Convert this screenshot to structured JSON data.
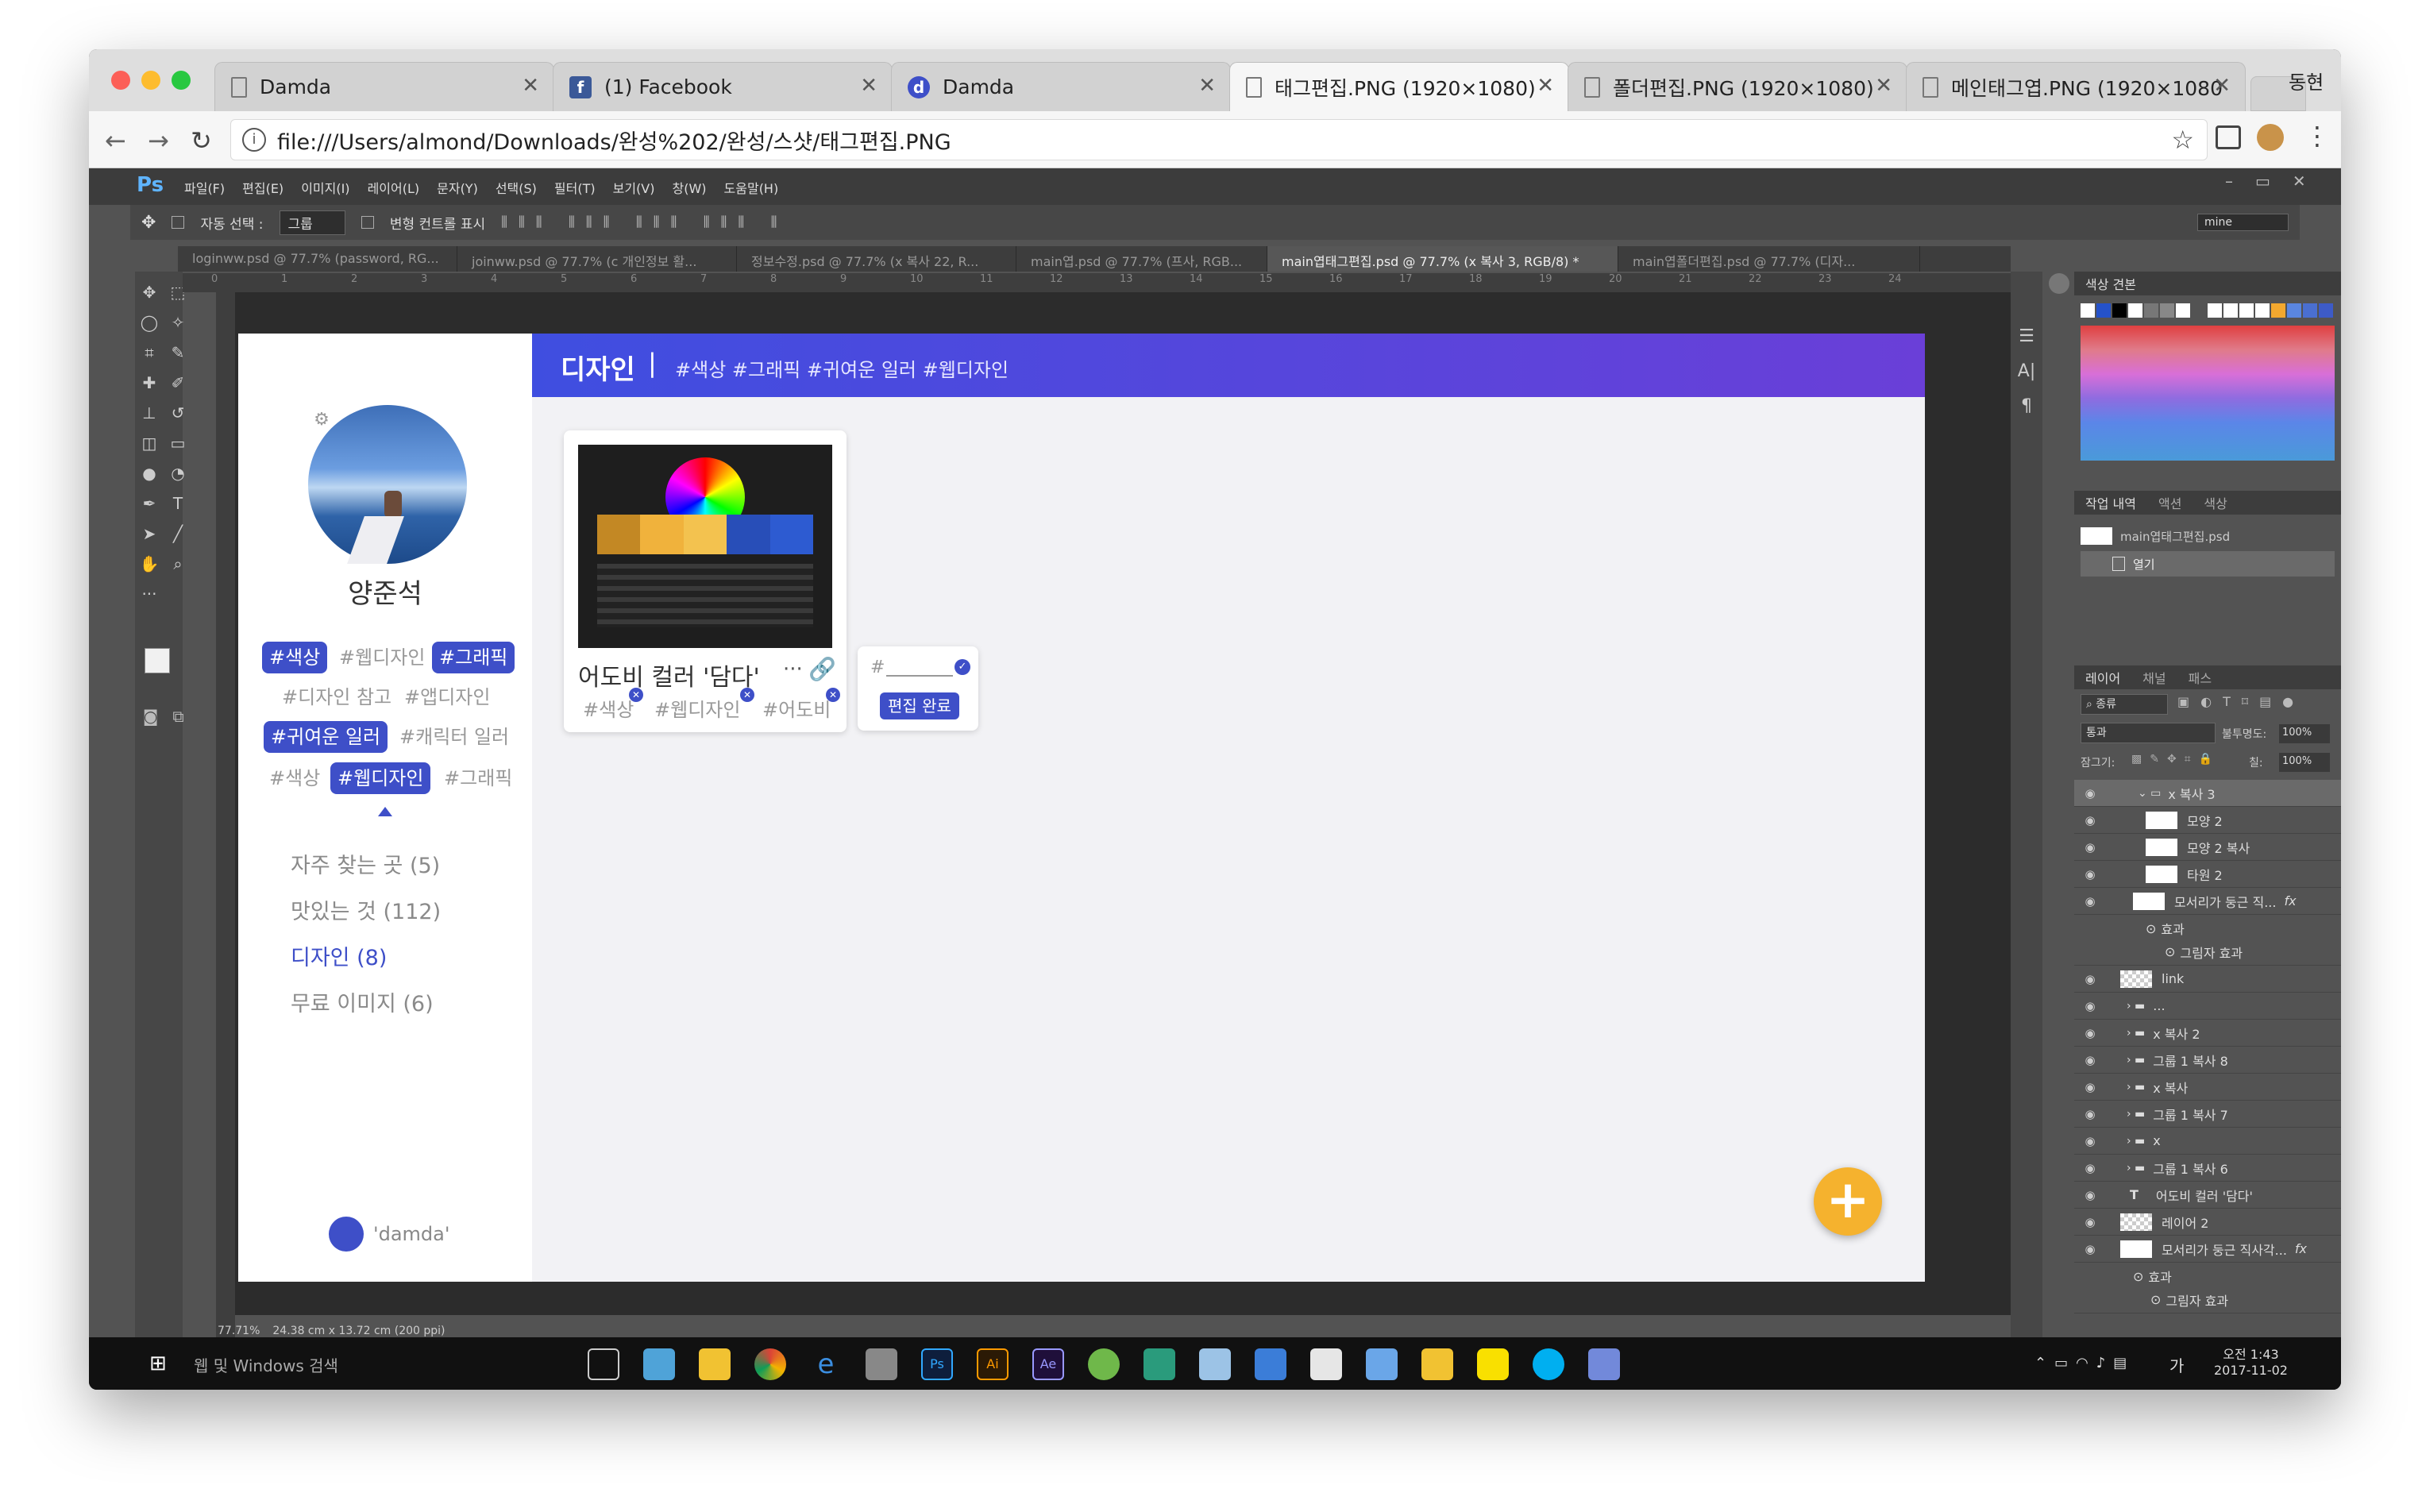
{
  "browser": {
    "tabs": [
      {
        "title": "Damda",
        "icon": "page-icon",
        "active": false
      },
      {
        "title": "(1) Facebook",
        "icon": "facebook-icon",
        "active": false
      },
      {
        "title": "Damda",
        "icon": "damda-icon",
        "active": false
      },
      {
        "title": "태그편집.PNG (1920×1080)",
        "icon": "page-icon",
        "active": true
      },
      {
        "title": "폴더편집.PNG (1920×1080)",
        "icon": "page-icon",
        "active": false
      },
      {
        "title": "메인태그엽.PNG (1920×1080",
        "icon": "page-icon",
        "active": false
      }
    ],
    "profile_label": "동현",
    "url": "file:///Users/almond/Downloads/완성%202/완성/스샷/태그편집.PNG"
  },
  "photoshop": {
    "logo": "Ps",
    "menu": [
      "파일(F)",
      "편집(E)",
      "이미지(I)",
      "레이어(L)",
      "문자(Y)",
      "선택(S)",
      "필터(T)",
      "보기(V)",
      "창(W)",
      "도움말(H)"
    ],
    "options": {
      "auto_select": "자동 선택 :",
      "auto_select_value": "그룹",
      "transform": "변형 컨트롤 표시",
      "workspace": "mine"
    },
    "doc_tabs": [
      {
        "label": "loginww.psd @ 77.7% (password, RG...",
        "active": false
      },
      {
        "label": "joinww.psd @ 77.7% (c 개인정보 활...",
        "active": false
      },
      {
        "label": "정보수정.psd @ 77.7% (x 복사 22, R...",
        "active": false
      },
      {
        "label": "main엽.psd @ 77.7% (프사, RGB...",
        "active": false
      },
      {
        "label": "main엽태그편집.psd @ 77.7% (x 복사 3, RGB/8) *",
        "active": true
      },
      {
        "label": "main엽폴더편집.psd @ 77.7% (디자...",
        "active": false
      }
    ],
    "ruler_marks": [
      "0",
      "1",
      "2",
      "3",
      "4",
      "5",
      "6",
      "7",
      "8",
      "9",
      "10",
      "11",
      "12",
      "13",
      "14",
      "15",
      "16",
      "17",
      "18",
      "19",
      "20",
      "21",
      "22",
      "23",
      "24"
    ],
    "status": {
      "zoom": "77.71%",
      "size": "24.38 cm x 13.72 cm (200 ppi)"
    },
    "swatches_title": "색상 견본",
    "history_tabs": [
      "작업 내역",
      "액션",
      "색상"
    ],
    "history_items": [
      "main엽태그편집.psd",
      "열기"
    ],
    "layers_tabs": [
      "레이어",
      "채널",
      "패스"
    ],
    "layer_kind": "종류",
    "blend_mode": "통과",
    "opacity_label": "불투명도:",
    "opacity": "100%",
    "lock_label": "잠그기:",
    "fill_label": "칠:",
    "fill": "100%",
    "layers": [
      {
        "name": "x 복사 3",
        "indent": 2,
        "type": "folder"
      },
      {
        "name": "모양 2",
        "indent": 3,
        "type": "shape"
      },
      {
        "name": "모양 2 복사",
        "indent": 3,
        "type": "shape"
      },
      {
        "name": "타원 2",
        "indent": 3,
        "type": "shape"
      },
      {
        "name": "모서리가 둥근 직...",
        "indent": 2,
        "type": "shape",
        "fx": "fx"
      },
      {
        "name": "효과",
        "indent": 3,
        "type": "effect"
      },
      {
        "name": "그림자 효과",
        "indent": 4,
        "type": "effect"
      },
      {
        "name": "link",
        "indent": 1,
        "type": "pixel"
      },
      {
        "name": "...",
        "indent": 1,
        "type": "folder"
      },
      {
        "name": "x 복사 2",
        "indent": 1,
        "type": "folder"
      },
      {
        "name": "그룹 1 복사 8",
        "indent": 1,
        "type": "folder"
      },
      {
        "name": "x 복사",
        "indent": 1,
        "type": "folder"
      },
      {
        "name": "그룹 1 복사 7",
        "indent": 1,
        "type": "folder"
      },
      {
        "name": "x",
        "indent": 1,
        "type": "folder"
      },
      {
        "name": "그룹 1 복사 6",
        "indent": 1,
        "type": "folder"
      },
      {
        "name": "어도비 컬러 '담다'",
        "indent": 1,
        "type": "text"
      },
      {
        "name": "레이어 2",
        "indent": 1,
        "type": "pixel"
      },
      {
        "name": "모서리가 둥근 직사각...",
        "indent": 1,
        "type": "shape",
        "fx": "fx"
      },
      {
        "name": "효과",
        "indent": 2,
        "type": "effect"
      },
      {
        "name": "그림자 효과",
        "indent": 3,
        "type": "effect"
      }
    ]
  },
  "app": {
    "user_name": "양준석",
    "tags": [
      {
        "label": "#색상",
        "selected": true
      },
      {
        "label": "#웹디자인",
        "selected": false
      },
      {
        "label": "#그래픽",
        "selected": true
      },
      {
        "label": "#디자인 참고",
        "selected": false
      },
      {
        "label": "#앱디자인",
        "selected": false
      },
      {
        "label": "#귀여운 일러",
        "selected": true
      },
      {
        "label": "#캐릭터 일러",
        "selected": false
      },
      {
        "label": "#색상",
        "selected": false
      },
      {
        "label": "#웹디자인",
        "selected": true
      },
      {
        "label": "#그래픽",
        "selected": false
      }
    ],
    "categories": [
      {
        "label": "자주 찾는 곳 (5)",
        "active": false
      },
      {
        "label": "맛있는 것 (112)",
        "active": false
      },
      {
        "label": "디자인 (8)",
        "active": true
      },
      {
        "label": "무료 이미지 (6)",
        "active": false
      }
    ],
    "logo_text": "'damda'",
    "header_title": "디자인",
    "header_divider": "|",
    "header_tags": "#색상 #그래픽 #귀여운 일러 #웹디자인",
    "card": {
      "title": "어도비 컬러 '담다'",
      "more": "···",
      "tags": [
        "#색상",
        "#웹디자인",
        "#어도비"
      ]
    },
    "tag_editor": {
      "placeholder": "#",
      "button": "편집 완료"
    },
    "fab": "+"
  },
  "taskbar": {
    "search": "웹 및 Windows 검색",
    "time": "오전 1:43",
    "date": "2017-11-02",
    "ime": "가"
  },
  "colors": {
    "accent": "#3e4fc8",
    "fab": "#f5b22e",
    "ps_bg": "#535353"
  }
}
